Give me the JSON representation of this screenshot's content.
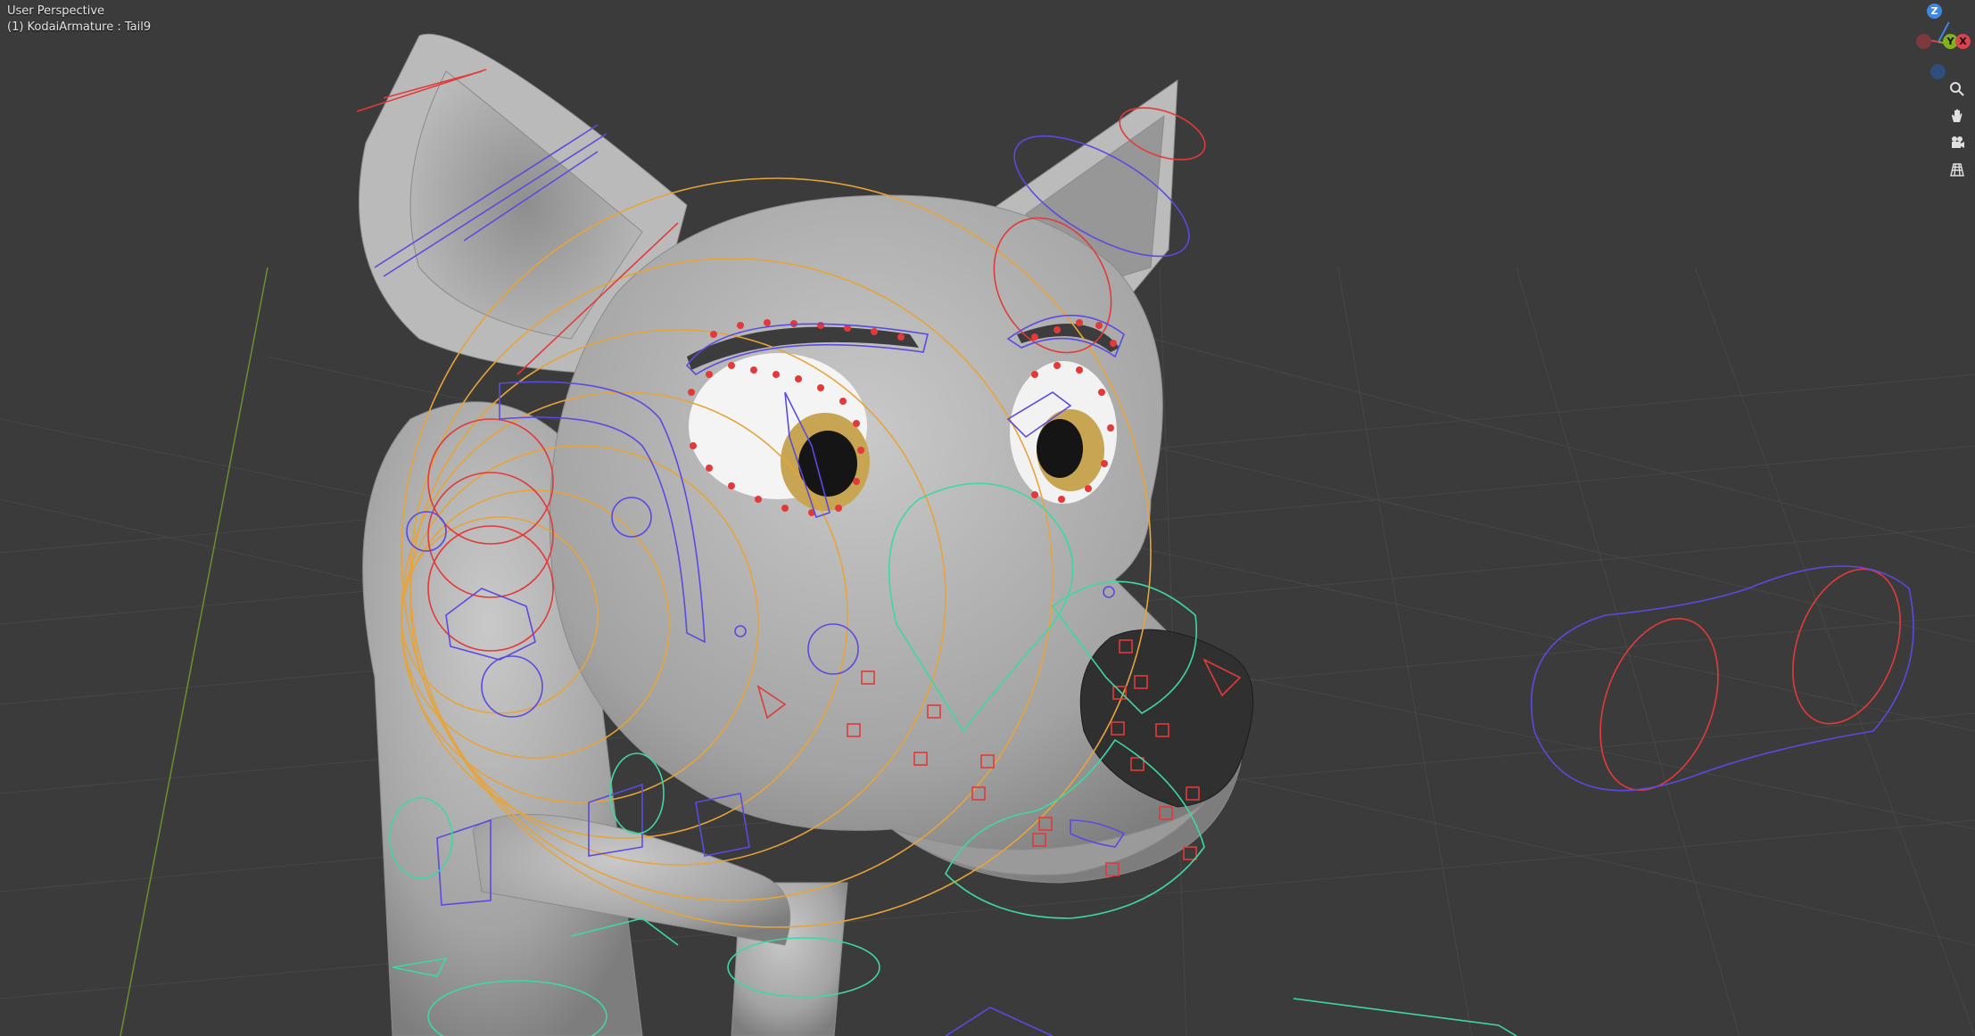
{
  "viewport": {
    "mode_label": "User Perspective",
    "object_label": "(1) KodaiArmature : Tail9"
  },
  "gizmo": {
    "z_label": "Z",
    "y_label": "Y",
    "x_label": "X",
    "x_color": "#d8434f",
    "y_color": "#7fb31c",
    "z_color": "#3f88e0"
  },
  "navigation": {
    "zoom_icon": "zoom-icon",
    "pan_icon": "hand-icon",
    "camera_icon": "camera-icon",
    "ortho_icon": "grid-icon"
  },
  "colors": {
    "background": "#3b3b3b",
    "mesh": "#b8b8b8",
    "bone_red": "#e23a3a",
    "bone_blue": "#5a4be0",
    "bone_orange": "#e6a43a",
    "bone_green": "#3ed8a0"
  }
}
